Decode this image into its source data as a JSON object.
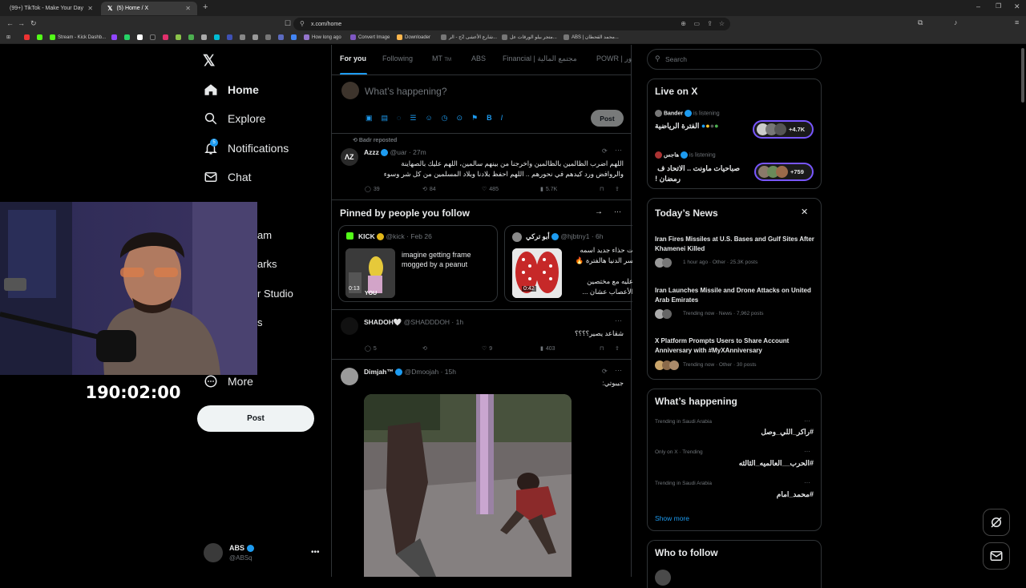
{
  "browser": {
    "tabs": [
      {
        "label": "(99+) TikTok - Make Your Day"
      },
      {
        "label": "(5) Home / X"
      }
    ],
    "url": "x.com/home",
    "bookmarks": [
      "Stream - Kick Dashb...",
      "How long ago",
      "Convert Image",
      "Downloader",
      "شارع الأعشى 2ج - الر...",
      "متجر بيلو الورقات عل...",
      "ABS | محمد القحطان..."
    ]
  },
  "nav": {
    "items": [
      {
        "label": "Home"
      },
      {
        "label": "Explore"
      },
      {
        "label": "Notifications",
        "badge": "5"
      },
      {
        "label": "Chat"
      },
      {
        "label": "More"
      }
    ],
    "partial": [
      "am",
      "arks",
      "r Studio",
      "s"
    ],
    "post_label": "Post",
    "account": {
      "name": "ABS",
      "handle": "@ABSq"
    }
  },
  "webcam": {
    "timer": "190:02:00"
  },
  "center": {
    "tabs": [
      "For you",
      "Following",
      "MT",
      "ABS",
      "Financial | مجتمع المالية",
      "POWR | ور"
    ],
    "tabs_tm": "TM",
    "compose": {
      "placeholder": "What’s happening?",
      "post_label": "Post"
    },
    "tweet1": {
      "repost": "Badr reposted",
      "name": "Azzz",
      "handle": "@uar · 27m",
      "text1": "اللهم اضرب الظالمين بالظالمين واخرجنا من بينهم سالمين، اللهم عليك بالصهاينة",
      "text2": "والروافض ورد كيدهم في نحورهم .. اللهم احفظ بلادنا وبلاد المسلمين من كل شر وسوء",
      "replies": "39",
      "reposts": "84",
      "likes": "485",
      "views": "5.7K"
    },
    "pinned": {
      "title": "Pinned by people you follow",
      "card1": {
        "name": "KICK",
        "handle": "@kick · Feb 26",
        "text": "imagine getting frame mogged by a peanut",
        "duration": "0:13",
        "you": "YOU"
      },
      "card2": {
        "name": "أبو تركي",
        "handle": "@hjbtny1 · 6h",
        "text1": "ت حذاء جديد اسمه",
        "text2": "سر الدنيا هالفترة 🔥",
        "text3": "عليه مع مختصين",
        "text4": "الأعصاب عشان ...",
        "duration": "0:42"
      }
    },
    "tweet2": {
      "name": "SHADOH🤍",
      "handle": "@SHADDDOH · 1h",
      "text": "شقاعد يصير؟؟؟؟",
      "replies": "5",
      "likes": "9",
      "views": "403"
    },
    "tweet3": {
      "name": "Dimjah™",
      "handle": "@Dmoojah · 15h",
      "text": "جيبوتي:"
    }
  },
  "right": {
    "search_placeholder": "Search",
    "live": {
      "title": "Live on X",
      "items": [
        {
          "host": "Bander",
          "status": "is listening",
          "title": "الفترة الرياضية",
          "count": "+4.7K"
        },
        {
          "host": "هاجس",
          "status": "is listening",
          "title1": "صباحيات ماونت .. الاتحاد ف",
          "title2": "رمضان !",
          "count": "+759"
        }
      ]
    },
    "news": {
      "title": "Today’s News",
      "items": [
        {
          "headline": "Iran Fires Missiles at U.S. Bases and Gulf Sites After Khamenei Killed",
          "meta": "1 hour ago · Other · 25.3K posts"
        },
        {
          "headline": "Iran Launches Missile and Drone Attacks on United Arab Emirates",
          "meta": "Trending now · News · 7,962 posts"
        },
        {
          "headline": "X Platform Prompts Users to Share Account Anniversary with #MyXAnniversary",
          "meta": "Trending now · Other · 30 posts"
        }
      ]
    },
    "happening": {
      "title": "What’s happening",
      "items": [
        {
          "context": "Trending in Saudi Arabia",
          "tag": "#راكر_اللي_وصل"
        },
        {
          "context": "Only on X · Trending",
          "tag": "#الحرب__العالميه_الثالثه"
        },
        {
          "context": "Trending in Saudi Arabia",
          "tag": "#محمد_امام"
        }
      ],
      "show_more": "Show more"
    },
    "follow": {
      "title": "Who to follow"
    }
  },
  "colors": {
    "accent": "#1d9bf0",
    "bg": "#000000",
    "border": "#2f3336",
    "muted": "#71767b"
  }
}
